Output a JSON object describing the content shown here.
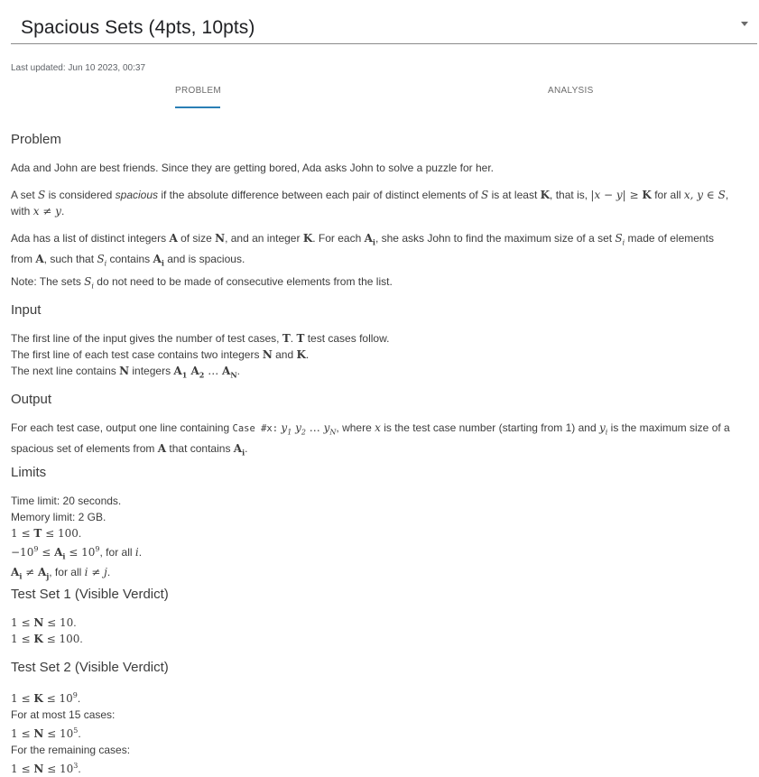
{
  "header": {
    "title": "Spacious Sets (4pts, 10pts)",
    "last_updated": "Last updated: Jun 10 2023, 00:37"
  },
  "tabs": [
    {
      "label": "PROBLEM",
      "active": true
    },
    {
      "label": "ANALYSIS",
      "active": false
    }
  ],
  "accent_color": "#2a7fb5",
  "sections": {
    "problem": "Problem",
    "input": "Input",
    "output": "Output",
    "limits": "Limits",
    "test_set_1": "Test Set 1 (Visible Verdict)",
    "test_set_2": "Test Set 2 (Visible Verdict)"
  },
  "problem": {
    "p1": "Ada and John are best friends. Since they are getting bored, Ada asks John to solve a puzzle for her.",
    "p2_a": "A set ",
    "p2_b": " is considered ",
    "p2_spacious": "spacious",
    "p2_c": " if the absolute difference between each pair of distinct elements of ",
    "p2_d": " is at least ",
    "p2_e": ", that is, ",
    "p2_f": " for all ",
    "p2_g": "with ",
    "p3_a": "Ada has a list of distinct integers ",
    "p3_b": " of size ",
    "p3_c": ", and an integer ",
    "p3_d": ". For each ",
    "p3_e": ", she asks John to find the maximum size of a set ",
    "p3_f": " made of elements",
    "p3_g": "from ",
    "p3_h": ", such that ",
    "p3_i": " contains ",
    "p3_j": " and is spacious.",
    "note_a": "Note: The sets ",
    "note_b": " do not need to be made of consecutive elements from the list."
  },
  "input": {
    "l1_a": "The first line of the input gives the number of test cases, ",
    "l1_b": " test cases follow.",
    "l2_a": "The first line of each test case contains two integers ",
    "l2_b": " and ",
    "l3_a": "The next line contains ",
    "l3_b": " integers "
  },
  "output": {
    "l1_a": "For each test case, output one line containing ",
    "l1_code": "Case #x:",
    "l1_b": ", where ",
    "l1_c": " is the test case number (starting from 1) and ",
    "l1_d": " is the maximum size of a",
    "l2_a": "spacious set of elements from ",
    "l2_b": " that contains "
  },
  "limits": {
    "time": "Time limit: 20 seconds.",
    "memory": "Memory limit: 2 GB.",
    "for_all": ", for all "
  },
  "test_set_2": {
    "at_most": "For at most 15 cases:",
    "remaining": "For the remaining cases:"
  }
}
